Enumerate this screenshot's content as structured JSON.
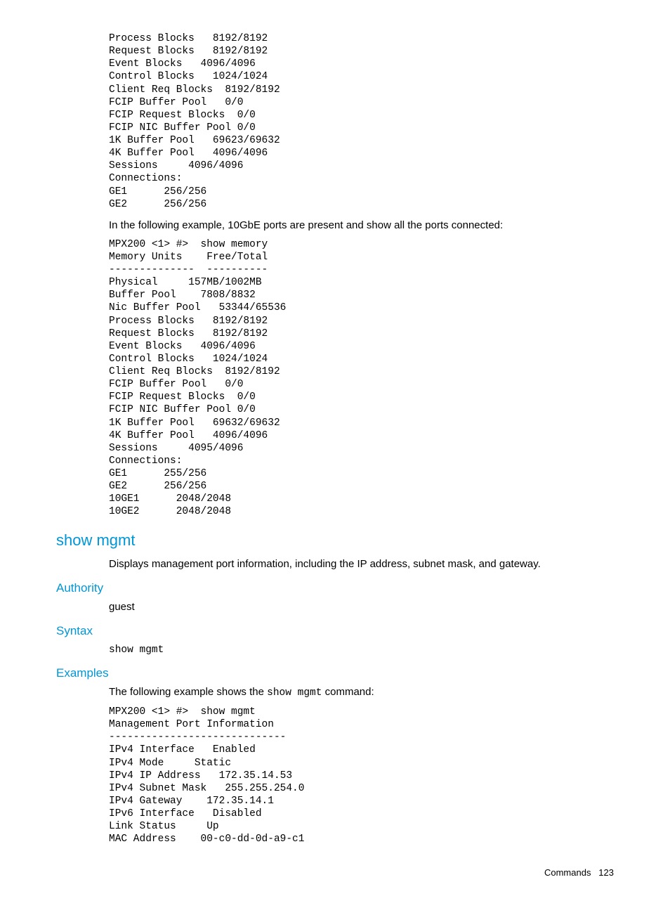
{
  "pre_block_1": "Process Blocks   8192/8192\nRequest Blocks   8192/8192\nEvent Blocks   4096/4096\nControl Blocks   1024/1024\nClient Req Blocks  8192/8192\nFCIP Buffer Pool   0/0\nFCIP Request Blocks  0/0\nFCIP NIC Buffer Pool 0/0\n1K Buffer Pool   69623/69632\n4K Buffer Pool   4096/4096\nSessions     4096/4096\nConnections:\nGE1      256/256\nGE2      256/256",
  "para_1": "In the following example, 10GbE ports are present and show all the ports connected:",
  "pre_block_2": "MPX200 <1> #>  show memory\nMemory Units    Free/Total\n--------------  ----------\nPhysical     157MB/1002MB\nBuffer Pool    7808/8832\nNic Buffer Pool   53344/65536\nProcess Blocks   8192/8192\nRequest Blocks   8192/8192\nEvent Blocks   4096/4096\nControl Blocks   1024/1024\nClient Req Blocks  8192/8192\nFCIP Buffer Pool   0/0\nFCIP Request Blocks  0/0\nFCIP NIC Buffer Pool 0/0\n1K Buffer Pool   69632/69632\n4K Buffer Pool   4096/4096\nSessions     4095/4096\nConnections:\nGE1      255/256\nGE2      256/256\n10GE1      2048/2048\n10GE2      2048/2048",
  "heading_main": "show mgmt",
  "para_desc": "Displays management port information, including the IP address, subnet mask, and gateway.",
  "heading_authority": "Authority",
  "para_guest": "guest",
  "heading_syntax": "Syntax",
  "pre_syntax": "show mgmt",
  "heading_examples": "Examples",
  "para_examples_pre": "The following example shows the ",
  "para_examples_code": "show mgmt",
  "para_examples_post": " command:",
  "pre_block_3": "MPX200 <1> #>  show mgmt\nManagement Port Information\n-----------------------------\nIPv4 Interface   Enabled\nIPv4 Mode     Static\nIPv4 IP Address   172.35.14.53\nIPv4 Subnet Mask   255.255.254.0\nIPv4 Gateway    172.35.14.1\nIPv6 Interface   Disabled\nLink Status     Up\nMAC Address    00-c0-dd-0d-a9-c1",
  "footer_label": "Commands",
  "footer_page": "123"
}
